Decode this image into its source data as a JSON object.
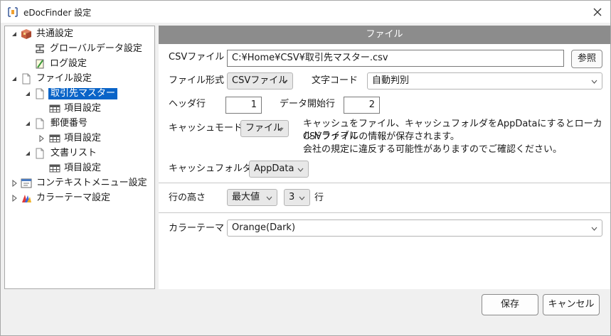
{
  "window": {
    "title": "eDocFinder 設定"
  },
  "tree": [
    {
      "label": "共通設定",
      "icon": "package-icon"
    },
    {
      "label": "グローバルデータ設定",
      "icon": "data-icon"
    },
    {
      "label": "ログ設定",
      "icon": "log-icon"
    },
    {
      "label": "ファイル設定",
      "icon": "file-icon"
    },
    {
      "label": "取引先マスター",
      "icon": "file-icon",
      "selected": true
    },
    {
      "label": "項目設定",
      "icon": "table-icon"
    },
    {
      "label": "郵便番号",
      "icon": "file-icon"
    },
    {
      "label": "項目設定",
      "icon": "table-icon"
    },
    {
      "label": "文書リスト",
      "icon": "file-icon"
    },
    {
      "label": "項目設定",
      "icon": "table-icon"
    },
    {
      "label": "コンテキストメニュー設定",
      "icon": "menu-icon"
    },
    {
      "label": "カラーテーマ設定",
      "icon": "palette-icon"
    }
  ],
  "panel": {
    "header": "ファイル",
    "csv_file_label": "CSVファイル",
    "csv_file_value": "C:¥Home¥CSV¥取引先マスター.csv",
    "browse_label": "参照",
    "file_format_label": "ファイル形式",
    "file_format_value": "CSVファイル",
    "char_code_label": "文字コード",
    "char_code_value": "自動判別",
    "header_row_label": "ヘッダ行",
    "header_row_value": "1",
    "data_start_label": "データ開始行",
    "data_start_value": "2",
    "cache_mode_label": "キャッシュモード",
    "cache_mode_value": "ファイル",
    "cache_note_1": "キャッシュをファイル、キャッシュフォルダをAppDataにするとローカルドライブに",
    "cache_note_2": "CSVファイルの情報が保存されます。",
    "cache_note_3": "会社の規定に違反する可能性がありますのでご確認ください。",
    "cache_folder_label": "キャッシュフォルダ",
    "cache_folder_value": "AppData",
    "row_height_label": "行の高さ",
    "row_height_mode": "最大値",
    "row_height_count": "3",
    "row_unit": "行",
    "color_theme_label": "カラーテーマ",
    "color_theme_value": "Orange(Dark)"
  },
  "footer": {
    "save_label": "保存",
    "cancel_label": "キャンセル"
  }
}
